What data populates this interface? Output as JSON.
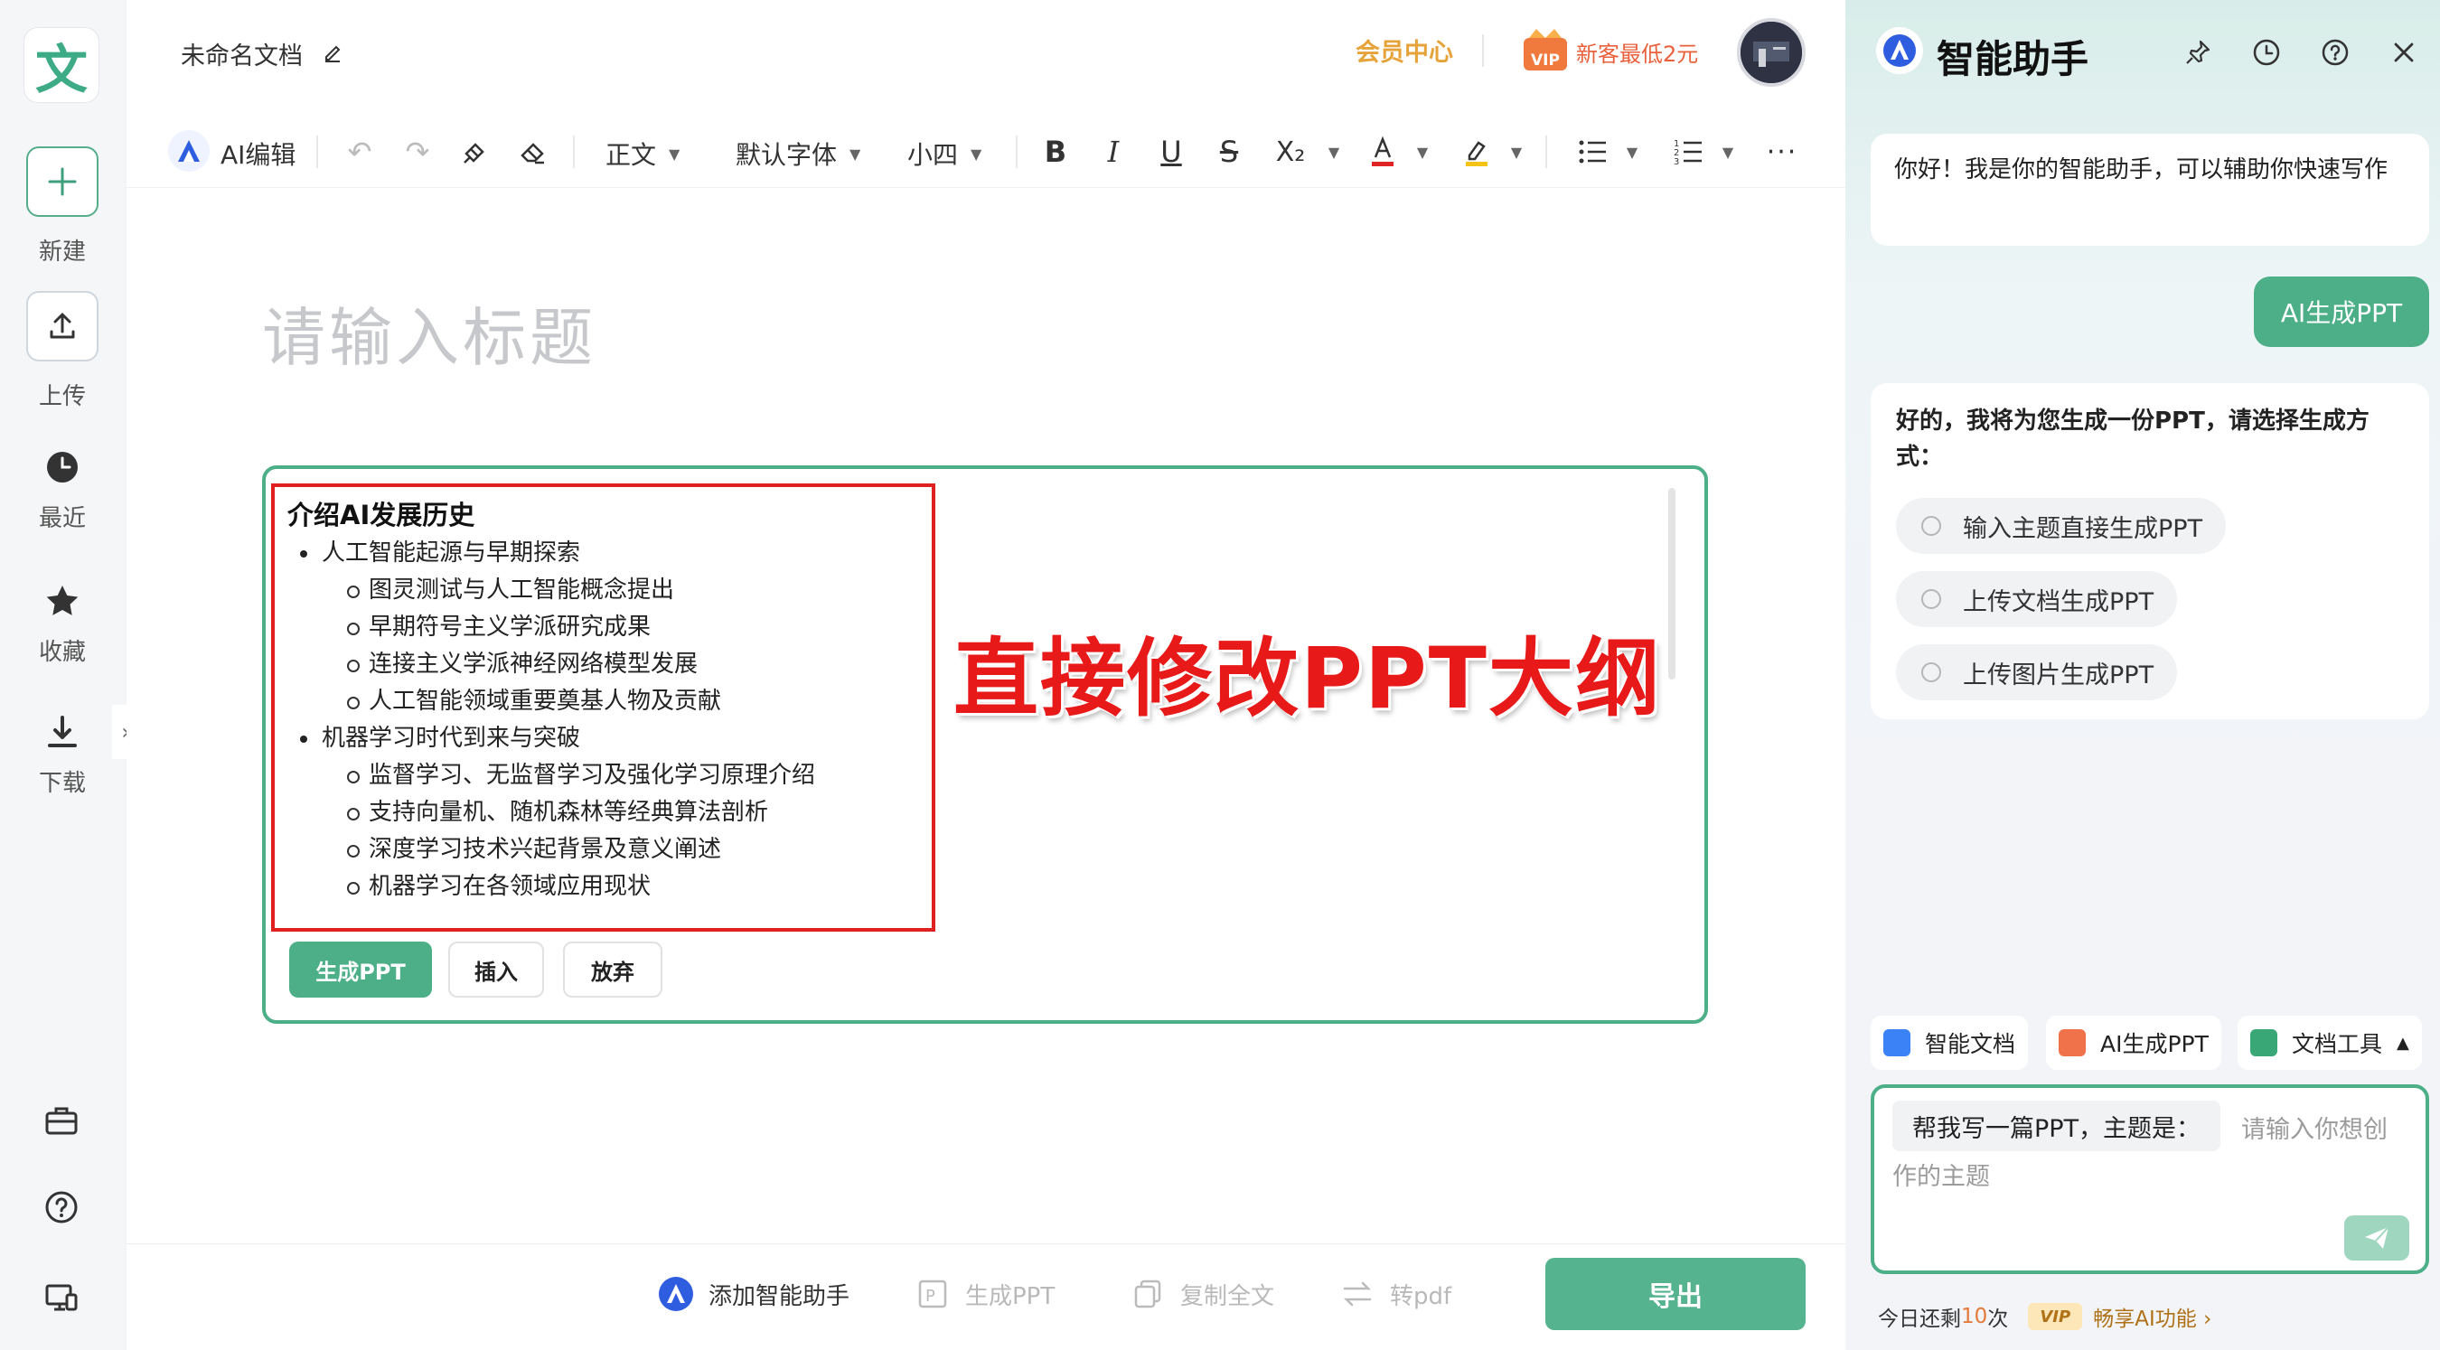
{
  "app": {
    "logo_char": "文",
    "brand_color": "#4caf88"
  },
  "rail": {
    "new_label": "新建",
    "upload_label": "上传",
    "recent_label": "最近",
    "favorites_label": "收藏",
    "download_label": "下载"
  },
  "header": {
    "doc_title": "未命名文档",
    "vip_center": "会员中心",
    "promo": "新客最低2元",
    "vip_icon_text": "VIP"
  },
  "toolbar": {
    "ai_edit": "AI编辑",
    "paragraph_style": "正文",
    "font_family": "默认字体",
    "font_size": "小四",
    "sub_label": "X₂"
  },
  "editor": {
    "title_placeholder": "请输入标题"
  },
  "outline": {
    "title": "介绍AI发展历史",
    "sections": [
      {
        "heading": "人工智能起源与早期探索",
        "items": [
          "图灵测试与人工智能概念提出",
          "早期符号主义学派研究成果",
          "连接主义学派神经网络模型发展",
          "人工智能领域重要奠基人物及贡献"
        ]
      },
      {
        "heading": "机器学习时代到来与突破",
        "items": [
          "监督学习、无监督学习及强化学习原理介绍",
          "支持向量机、随机森林等经典算法剖析",
          "深度学习技术兴起背景及意义阐述",
          "机器学习在各领域应用现状"
        ]
      }
    ],
    "overlay_caption": "直接修改PPT大纲",
    "btn_generate": "生成PPT",
    "btn_insert": "插入",
    "btn_discard": "放弃"
  },
  "bottom": {
    "add_assistant": "添加智能助手",
    "generate_ppt": "生成PPT",
    "copy_all": "复制全文",
    "to_pdf": "转pdf",
    "export": "导出"
  },
  "assistant": {
    "title": "智能助手",
    "greeting": "你好！我是你的智能助手，可以辅助你快速写作",
    "user_message": "AI生成PPT",
    "reply": "好的，我将为您生成一份PPT，请选择生成方式：",
    "options": [
      "输入主题直接生成PPT",
      "上传文档生成PPT",
      "上传图片生成PPT"
    ],
    "chips": [
      "智能文档",
      "AI生成PPT",
      "文档工具"
    ],
    "prompt_prefix": "帮我写一篇PPT，主题是：",
    "placeholder_1": "请输入你想创",
    "placeholder_2": "作的主题",
    "quota_prefix": "今日还剩",
    "quota_count": "10",
    "quota_suffix": "次",
    "vip_badge": "VIP",
    "vip_cta": "畅享AI功能 ›"
  }
}
